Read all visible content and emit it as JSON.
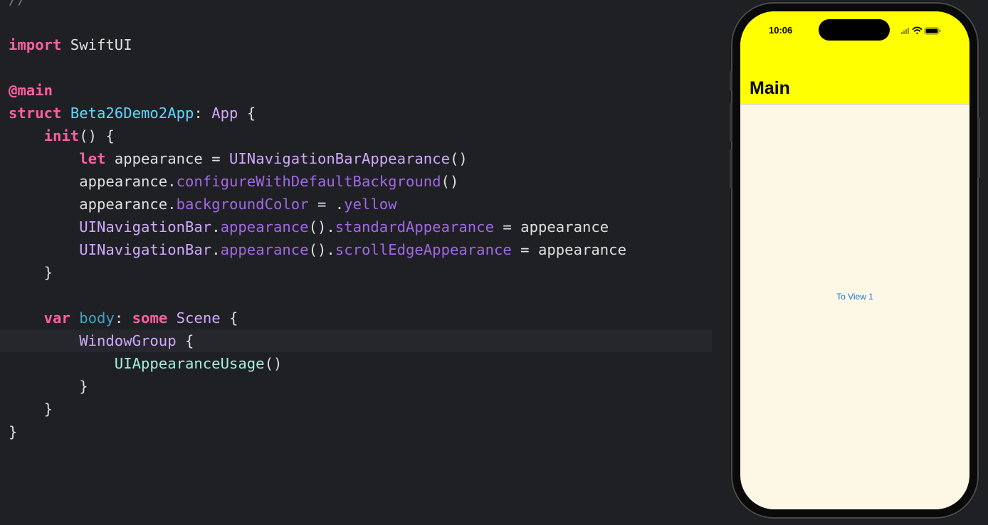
{
  "editor": {
    "lines": [
      {
        "tokens": [
          {
            "t": "//",
            "c": "comment"
          }
        ]
      },
      {
        "tokens": []
      },
      {
        "tokens": [
          {
            "t": "import",
            "c": "kw"
          },
          {
            "t": " SwiftUI",
            "c": "plain"
          }
        ]
      },
      {
        "tokens": []
      },
      {
        "tokens": [
          {
            "t": "@main",
            "c": "kw"
          }
        ]
      },
      {
        "tokens": [
          {
            "t": "struct",
            "c": "kw"
          },
          {
            "t": " ",
            "c": "plain"
          },
          {
            "t": "Beta26Demo2App",
            "c": "type-decl"
          },
          {
            "t": ": ",
            "c": "plain"
          },
          {
            "t": "App",
            "c": "type-ref"
          },
          {
            "t": " {",
            "c": "plain"
          }
        ]
      },
      {
        "tokens": [
          {
            "t": "    ",
            "c": "plain"
          },
          {
            "t": "init",
            "c": "kw"
          },
          {
            "t": "() {",
            "c": "plain"
          }
        ]
      },
      {
        "tokens": [
          {
            "t": "        ",
            "c": "plain"
          },
          {
            "t": "let",
            "c": "kw"
          },
          {
            "t": " appearance = ",
            "c": "plain"
          },
          {
            "t": "UINavigationBarAppearance",
            "c": "type-ref"
          },
          {
            "t": "()",
            "c": "plain"
          }
        ]
      },
      {
        "tokens": [
          {
            "t": "        appearance.",
            "c": "plain"
          },
          {
            "t": "configureWithDefaultBackground",
            "c": "member"
          },
          {
            "t": "()",
            "c": "plain"
          }
        ]
      },
      {
        "tokens": [
          {
            "t": "        appearance.",
            "c": "plain"
          },
          {
            "t": "backgroundColor",
            "c": "member"
          },
          {
            "t": " = .",
            "c": "plain"
          },
          {
            "t": "yellow",
            "c": "member"
          }
        ]
      },
      {
        "tokens": [
          {
            "t": "        ",
            "c": "plain"
          },
          {
            "t": "UINavigationBar",
            "c": "type-ref"
          },
          {
            "t": ".",
            "c": "plain"
          },
          {
            "t": "appearance",
            "c": "member"
          },
          {
            "t": "().",
            "c": "plain"
          },
          {
            "t": "standardAppearance",
            "c": "member"
          },
          {
            "t": " = appearance",
            "c": "plain"
          }
        ]
      },
      {
        "tokens": [
          {
            "t": "        ",
            "c": "plain"
          },
          {
            "t": "UINavigationBar",
            "c": "type-ref"
          },
          {
            "t": ".",
            "c": "plain"
          },
          {
            "t": "appearance",
            "c": "member"
          },
          {
            "t": "().",
            "c": "plain"
          },
          {
            "t": "scrollEdgeAppearance",
            "c": "member"
          },
          {
            "t": " = appearance",
            "c": "plain"
          }
        ]
      },
      {
        "tokens": [
          {
            "t": "    }",
            "c": "plain"
          }
        ]
      },
      {
        "tokens": []
      },
      {
        "tokens": [
          {
            "t": "    ",
            "c": "plain"
          },
          {
            "t": "var",
            "c": "kw"
          },
          {
            "t": " ",
            "c": "plain"
          },
          {
            "t": "body",
            "c": "proj-prop"
          },
          {
            "t": ": ",
            "c": "plain"
          },
          {
            "t": "some",
            "c": "kw"
          },
          {
            "t": " ",
            "c": "plain"
          },
          {
            "t": "Scene",
            "c": "type-ref"
          },
          {
            "t": " {",
            "c": "plain"
          }
        ]
      },
      {
        "current": true,
        "tokens": [
          {
            "t": "        ",
            "c": "plain"
          },
          {
            "t": "WindowGroup",
            "c": "type-ref"
          },
          {
            "t": " {",
            "c": "plain"
          }
        ]
      },
      {
        "tokens": [
          {
            "t": "            ",
            "c": "plain"
          },
          {
            "t": "UIAppearanceUsage",
            "c": "proj-type"
          },
          {
            "t": "()",
            "c": "plain"
          }
        ]
      },
      {
        "tokens": [
          {
            "t": "        }",
            "c": "plain"
          }
        ]
      },
      {
        "tokens": [
          {
            "t": "    }",
            "c": "plain"
          }
        ]
      },
      {
        "tokens": [
          {
            "t": "}",
            "c": "plain"
          }
        ]
      }
    ]
  },
  "simulator": {
    "status_time": "10:06",
    "nav_title": "Main",
    "link_label": "To View 1",
    "nav_bar_color": "#ffff00",
    "content_background": "#fdf8e6",
    "link_color": "#1a73d9",
    "status_icons": [
      "signal-icon",
      "wifi-icon",
      "battery-icon"
    ]
  }
}
